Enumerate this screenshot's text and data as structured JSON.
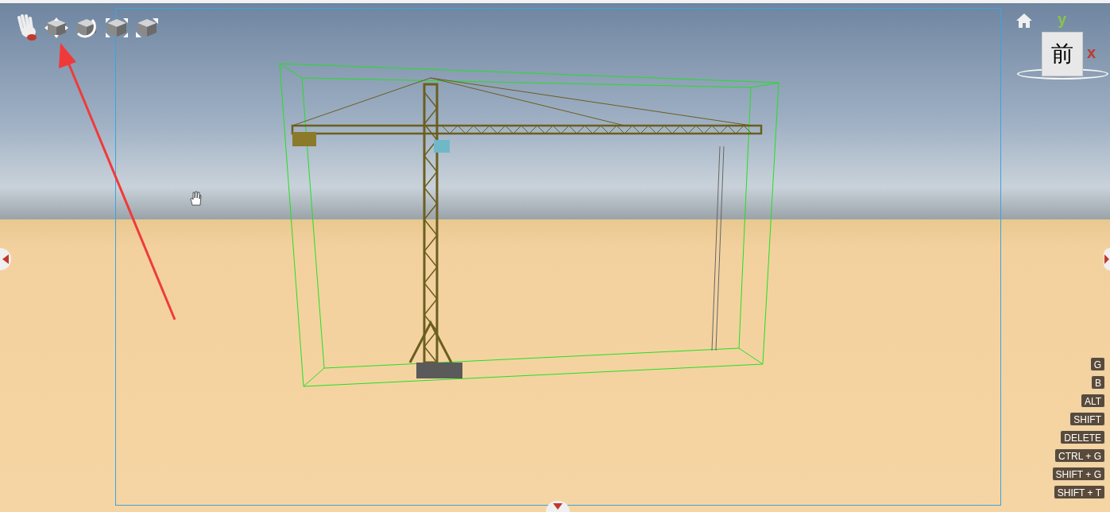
{
  "view_cube": {
    "face_label": "前",
    "axis_y": "y",
    "axis_x": "x"
  },
  "shortcut_keys": [
    "G",
    "B",
    "ALT",
    "SHIFT",
    "DELETE",
    "CTRL + G",
    "SHIFT + G",
    "SHIFT + T"
  ]
}
